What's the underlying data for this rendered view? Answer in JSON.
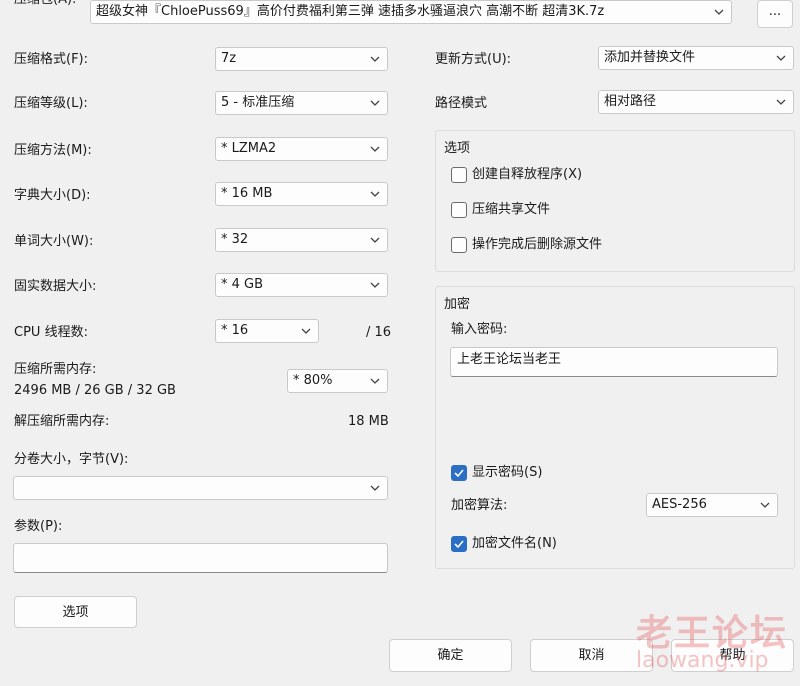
{
  "archive": {
    "label": "压缩包(A):",
    "filename": "超级女神『ChloePuss69』高价付费福利第三弹 速插多水骚逼浪穴 高潮不断 超清3K.7z",
    "browse_label": "..."
  },
  "left": {
    "format": {
      "label": "压缩格式(F):",
      "value": "7z"
    },
    "level": {
      "label": "压缩等级(L):",
      "value": "5 - 标准压缩"
    },
    "method": {
      "label": "压缩方法(M):",
      "value": "*  LZMA2"
    },
    "dict": {
      "label": "字典大小(D):",
      "value": "*  16 MB"
    },
    "word": {
      "label": "单词大小(W):",
      "value": "*  32"
    },
    "solid": {
      "label": "固实数据大小:",
      "value": "*  4 GB"
    },
    "threads": {
      "label": "CPU 线程数:",
      "value": "*  16",
      "max": "/ 16"
    },
    "mem_comp": {
      "label": "压缩所需内存:",
      "detail": "2496 MB / 26 GB / 32 GB",
      "value": "* 80%"
    },
    "mem_decomp": {
      "label": "解压缩所需内存:",
      "value": "18 MB"
    },
    "volume": {
      "label": "分卷大小，字节(V):",
      "value": ""
    },
    "params": {
      "label": "参数(P):",
      "value": ""
    },
    "options_button": "选项"
  },
  "right": {
    "update": {
      "label": "更新方式(U):",
      "value": "添加并替换文件"
    },
    "path": {
      "label": "路径模式",
      "value": "相对路径"
    },
    "options_group": {
      "title": "选项",
      "sfx": "创建自释放程序(X)",
      "shared": "压缩共享文件",
      "delete": "操作完成后删除源文件"
    },
    "encrypt_group": {
      "title": "加密",
      "password_label": "输入密码:",
      "password_value": "上老王论坛当老王",
      "show_password": "显示密码(S)",
      "method_label": "加密算法:",
      "method_value": "AES-256",
      "encrypt_names": "加密文件名(N)"
    }
  },
  "buttons": {
    "ok": "确定",
    "cancel": "取消",
    "help": "帮助"
  },
  "watermark": {
    "cn": "老王论坛",
    "en": "laowang.vip"
  },
  "colors": {
    "accent": "#2a6fc4",
    "watermark": "#e24646"
  }
}
